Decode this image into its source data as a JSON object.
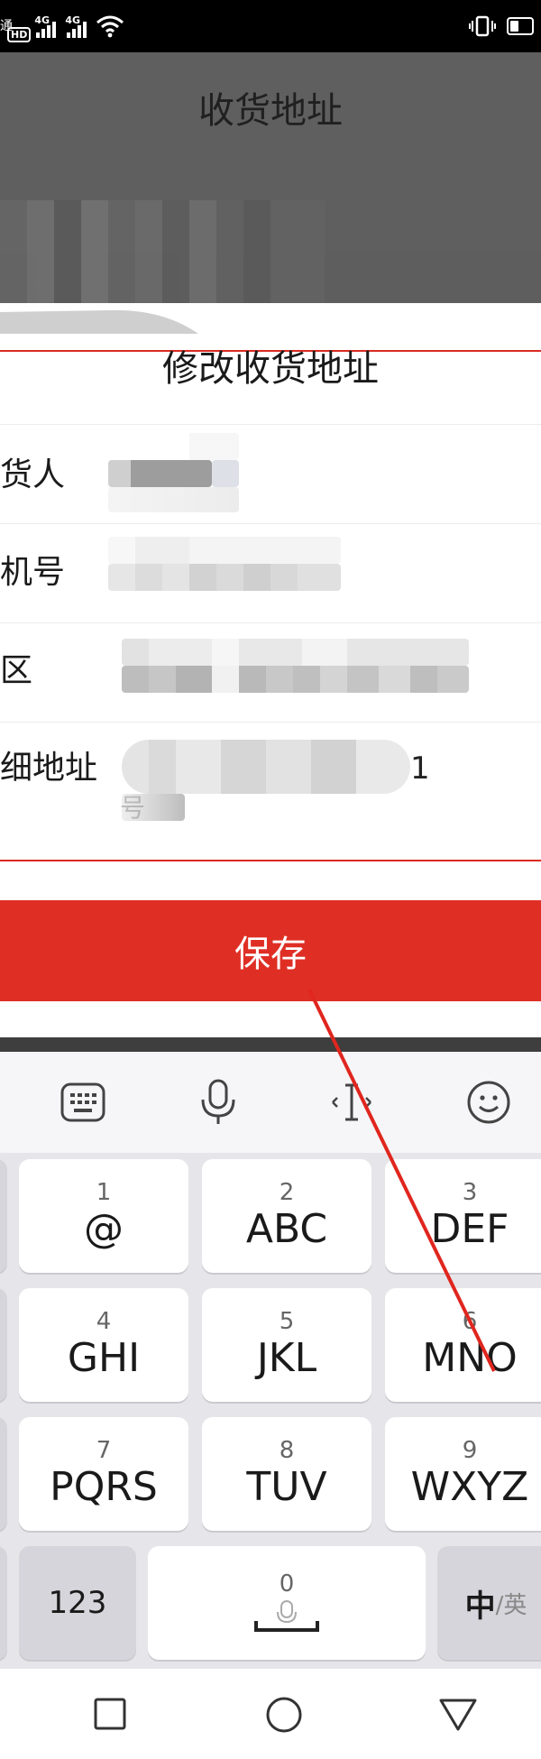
{
  "status_bar": {
    "carrier": "通",
    "hd": "HD",
    "signal1": "4G",
    "signal2": "4G"
  },
  "header": {
    "title": "收货地址"
  },
  "modal": {
    "title": "修改收货地址",
    "fields": [
      {
        "label": "货人",
        "value": ""
      },
      {
        "label": "机号",
        "value": ""
      },
      {
        "label": "区",
        "value": ""
      },
      {
        "label": "细地址",
        "value": "1",
        "value_line2": "号"
      }
    ]
  },
  "save_button": {
    "label": "保存"
  },
  "keyboard": {
    "toolbar": [
      "keyboard-grid-icon",
      "microphone-icon",
      "cursor-icon",
      "emoji-icon"
    ],
    "keys": [
      {
        "num": "1",
        "letters": "@"
      },
      {
        "num": "2",
        "letters": "ABC"
      },
      {
        "num": "3",
        "letters": "DEF"
      },
      {
        "num": "4",
        "letters": "GHI"
      },
      {
        "num": "5",
        "letters": "JKL"
      },
      {
        "num": "6",
        "letters": "MNO"
      },
      {
        "num": "7",
        "letters": "PQRS"
      },
      {
        "num": "8",
        "letters": "TUV"
      },
      {
        "num": "9",
        "letters": "WXYZ"
      }
    ],
    "num_key": "123",
    "space_num": "0",
    "lang_main": "中",
    "lang_alt": "/英"
  },
  "colors": {
    "accent": "#df2f25",
    "overlay": "#5f5f5f",
    "keyboard_bg": "#e6e6ea"
  }
}
